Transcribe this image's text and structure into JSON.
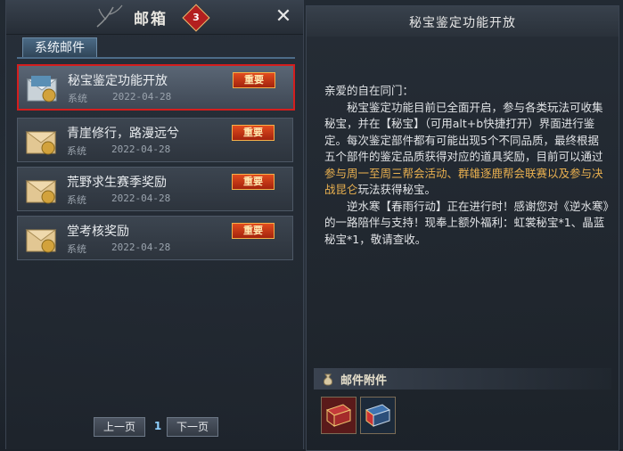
{
  "mailbox": {
    "title": "邮箱",
    "unread_count": "3",
    "tab_label": "系统邮件",
    "items": [
      {
        "title": "秘宝鉴定功能开放",
        "sender": "系统",
        "date": "2022-04-28",
        "tag": "重要"
      },
      {
        "title": "青崖修行，路漫远兮",
        "sender": "系统",
        "date": "2022-04-28",
        "tag": "重要"
      },
      {
        "title": "荒野求生赛季奖励",
        "sender": "系统",
        "date": "2022-04-28",
        "tag": "重要"
      },
      {
        "title": "堂考核奖励",
        "sender": "系统",
        "date": "2022-04-28",
        "tag": "重要"
      }
    ],
    "prev_label": "上一页",
    "page": "1",
    "next_label": "下一页"
  },
  "detail": {
    "title": "秘宝鉴定功能开放",
    "greeting": "亲爱的自在同门：",
    "p1_a": "　　秘宝鉴定功能目前已全面开启，参与各类玩法可收集秘宝，并在【秘宝】（可用alt+b快捷打开）界面进行鉴定。每次鉴定部件都有可能出现5个不同品质，最终根据五个部件的鉴定品质获得对应的道具奖励，目前可以通过",
    "p1_highlight": "参与周一至周三帮会活动、群雄逐鹿帮会联赛以及参与决战昆仑",
    "p1_b": "玩法获得秘宝。",
    "p2": "　　逆水寒【春雨行动】正在进行时！感谢您对《逆水寒》的一路陪伴与支持！现奉上额外福利：虹裳秘宝*1、晶蓝秘宝*1，敬请查收。",
    "attachments_label": "邮件附件"
  },
  "colors": {
    "highlight": "#e9b04f",
    "selected_border": "#d41e1e",
    "important_tag": "#c53a17"
  }
}
